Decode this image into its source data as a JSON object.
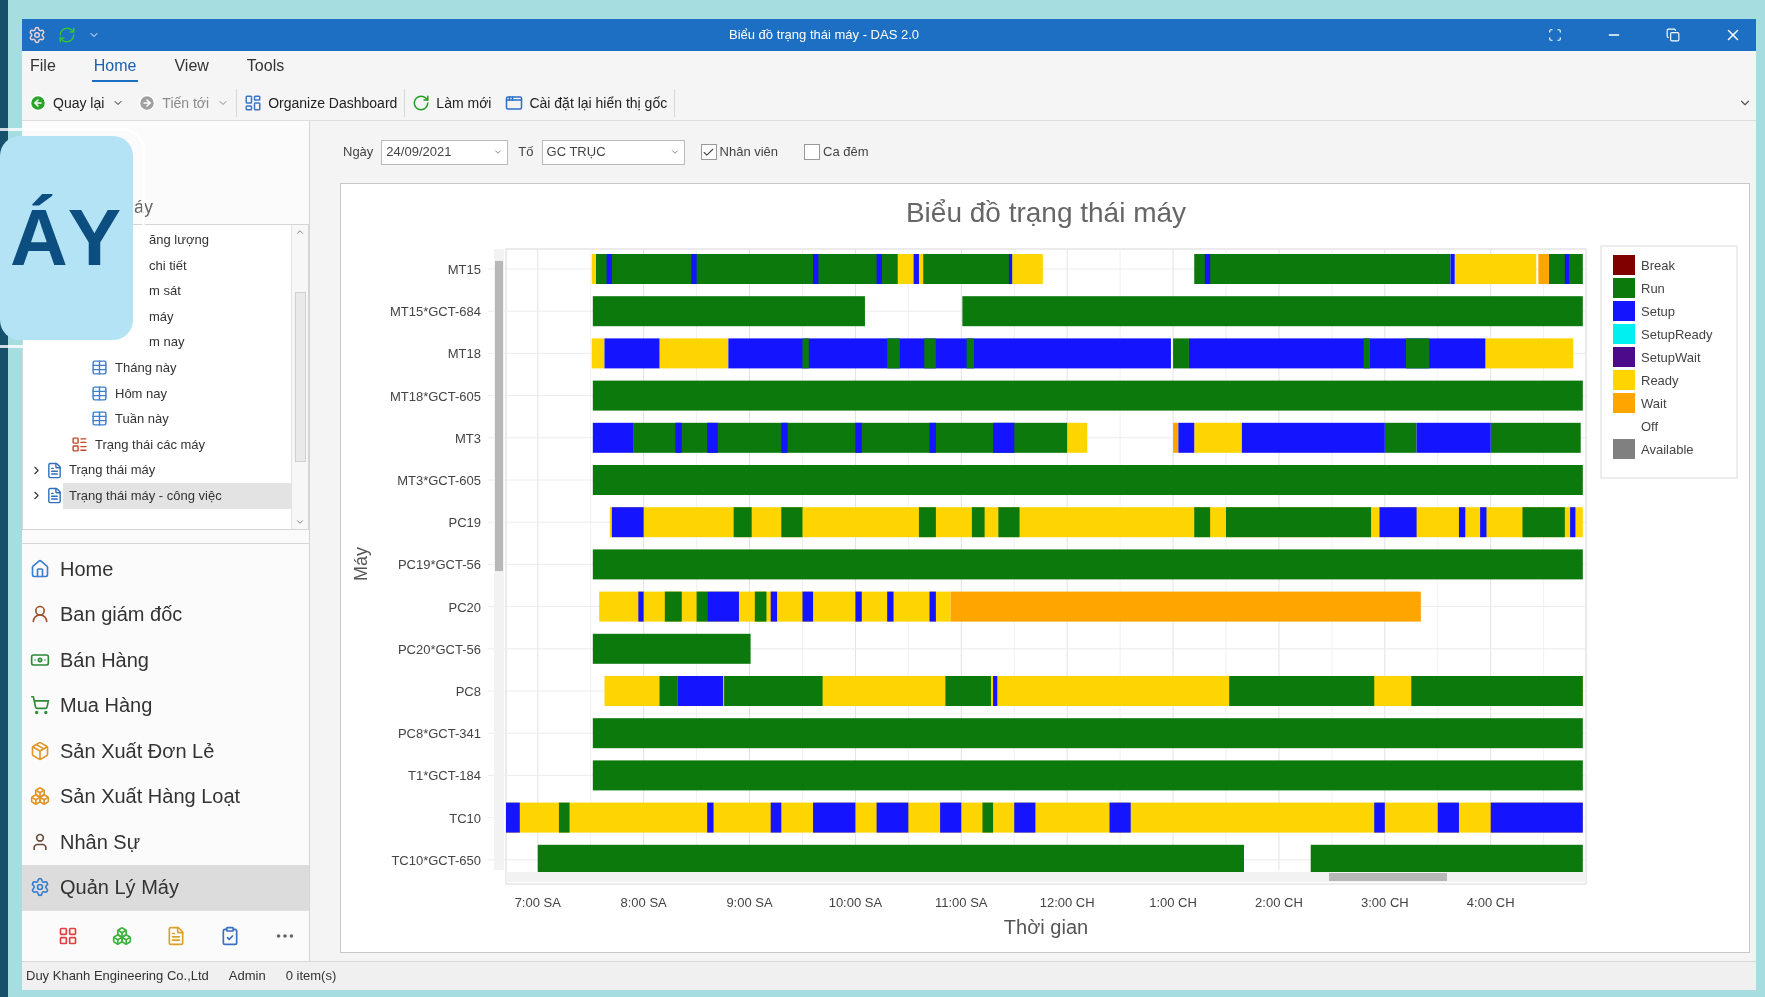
{
  "window": {
    "title": "Biểu đồ trạng thái máy - DAS 2.0"
  },
  "menu": [
    {
      "label": "File",
      "selected": false
    },
    {
      "label": "Home",
      "selected": true
    },
    {
      "label": "View",
      "selected": false
    },
    {
      "label": "Tools",
      "selected": false
    }
  ],
  "toolbar": [
    [
      {
        "label": "Quay lại",
        "dropdown": true,
        "disabled": false
      },
      {
        "label": "Tiến tới",
        "dropdown": true,
        "disabled": true
      }
    ],
    [
      {
        "label": "Organize Dashboard",
        "dropdown": false,
        "disabled": false
      }
    ],
    [
      {
        "label": "Làm mới",
        "dropdown": false,
        "disabled": false
      },
      {
        "label": "Cài đặt lại hiển thị gốc",
        "dropdown": false,
        "disabled": false
      }
    ]
  ],
  "overlay": {
    "title": "ÁY"
  },
  "sidebar": {
    "caption": "áy",
    "tree": [
      {
        "kind": "continuation",
        "children": [
          {
            "kind": "continuation",
            "children": [
              {
                "kind": "clipped",
                "label": "ăng lượng",
                "selected": false
              },
              {
                "kind": "clipped",
                "label": "chi tiết",
                "selected": false
              },
              {
                "kind": "clipped",
                "label": "m sát",
                "selected": false
              },
              {
                "kind": "clipped",
                "label": "máy",
                "selected": false
              },
              {
                "kind": "clipped",
                "label": "m nay",
                "selected": false
              },
              {
                "kind": "leaf",
                "label": "Tháng này",
                "selected": false
              },
              {
                "kind": "leaf",
                "label": "Hôm nay",
                "selected": false
              },
              {
                "kind": "leaf",
                "label": "Tuần này",
                "selected": false
              }
            ]
          },
          {
            "kind": "leaf",
            "label": "Trạng thái các máy",
            "selected": false
          }
        ]
      },
      {
        "kind": "folder",
        "label": "Trạng thái máy",
        "expanded": false,
        "selected": false
      },
      {
        "kind": "folder",
        "label": "Trạng thái máy - công việc",
        "expanded": false,
        "selected": true
      }
    ],
    "nav": [
      {
        "label": "Home",
        "selected": false
      },
      {
        "label": "Ban giám đốc",
        "selected": false
      },
      {
        "label": "Bán Hàng",
        "selected": false
      },
      {
        "label": "Mua Hàng",
        "selected": false
      },
      {
        "label": "Sản Xuất Đơn Lẻ",
        "selected": false
      },
      {
        "label": "Sản Xuất Hàng Loạt",
        "selected": false
      },
      {
        "label": "Nhân Sự",
        "selected": false
      },
      {
        "label": "Quản Lý Máy",
        "selected": true
      }
    ]
  },
  "filters": {
    "date_label": "Ngày",
    "date": "24/09/2021",
    "team_label": "Tố",
    "team": "GC TRỤC",
    "checks": [
      {
        "label": "Nhân viên",
        "checked": true
      },
      {
        "label": "Ca đêm",
        "checked": false
      }
    ]
  },
  "chart": {
    "title": "Biểu đồ trạng thái máy",
    "xlabel": "Thời gian",
    "ylabel": "Máy",
    "rows": [
      "MT15",
      "MT15*GCT-684",
      "MT18",
      "MT18*GCT-605",
      "MT3",
      "MT3*GCT-605",
      "PC19",
      "PC19*GCT-56",
      "PC20",
      "PC20*GCT-56",
      "PC8",
      "PC8*GCT-341",
      "T1*GCT-184",
      "TC10",
      "TC10*GCT-650"
    ],
    "time_labels": [
      "7:00 SA",
      "8:00 SA",
      "9:00 SA",
      "10:00 SA",
      "11:00 SA",
      "12:00 CH",
      "1:00 CH",
      "2:00 CH",
      "3:00 CH",
      "4:00 CH"
    ],
    "legend": [
      {
        "name": "Break",
        "color": "#800000"
      },
      {
        "name": "Run",
        "color": "#0b790b"
      },
      {
        "name": "Setup",
        "color": "#1414ff"
      },
      {
        "name": "SetupReady",
        "color": "#00f0f0"
      },
      {
        "name": "SetupWait",
        "color": "#4b0b8a"
      },
      {
        "name": "Ready",
        "color": "#ffd500"
      },
      {
        "name": "Wait",
        "color": "#ffa500"
      },
      {
        "name": "Off"
      },
      {
        "name": "Available",
        "color": "#808080"
      }
    ]
  },
  "status_bar": [
    "Duy Khanh Engineering Co.,Ltd",
    "Admin",
    "0 item(s)"
  ]
}
